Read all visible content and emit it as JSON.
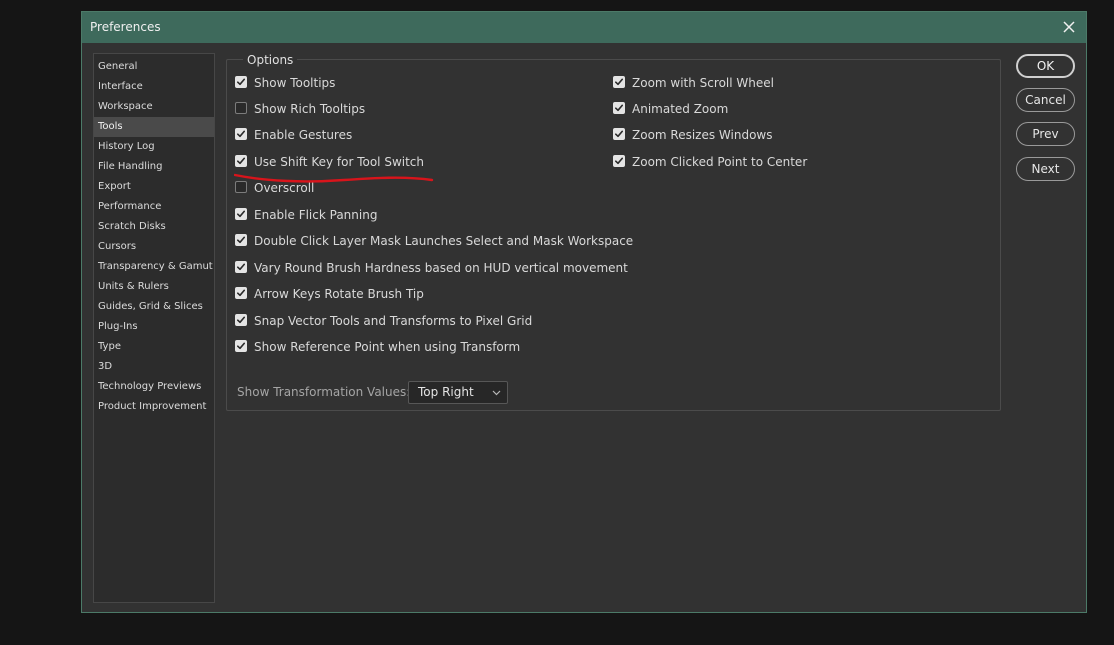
{
  "window": {
    "title": "Preferences"
  },
  "nav": {
    "items": [
      {
        "label": "General",
        "active": false
      },
      {
        "label": "Interface",
        "active": false
      },
      {
        "label": "Workspace",
        "active": false
      },
      {
        "label": "Tools",
        "active": true
      },
      {
        "label": "History Log",
        "active": false
      },
      {
        "label": "File Handling",
        "active": false
      },
      {
        "label": "Export",
        "active": false
      },
      {
        "label": "Performance",
        "active": false
      },
      {
        "label": "Scratch Disks",
        "active": false
      },
      {
        "label": "Cursors",
        "active": false
      },
      {
        "label": "Transparency & Gamut",
        "active": false
      },
      {
        "label": "Units & Rulers",
        "active": false
      },
      {
        "label": "Guides, Grid & Slices",
        "active": false
      },
      {
        "label": "Plug-Ins",
        "active": false
      },
      {
        "label": "Type",
        "active": false
      },
      {
        "label": "3D",
        "active": false
      },
      {
        "label": "Technology Previews",
        "active": false
      },
      {
        "label": "Product Improvement",
        "active": false
      }
    ]
  },
  "options": {
    "legend": "Options",
    "left": [
      {
        "label": "Show Tooltips",
        "checked": true
      },
      {
        "label": "Show Rich Tooltips",
        "checked": false
      },
      {
        "label": "Enable Gestures",
        "checked": true
      },
      {
        "label": "Use Shift Key for Tool Switch",
        "checked": true
      },
      {
        "label": "Overscroll",
        "checked": false
      },
      {
        "label": "Enable Flick Panning",
        "checked": true
      },
      {
        "label": "Double Click Layer Mask Launches Select and Mask Workspace",
        "checked": true
      },
      {
        "label": "Vary Round Brush Hardness based on HUD vertical movement",
        "checked": true
      },
      {
        "label": "Arrow Keys Rotate Brush Tip",
        "checked": true
      },
      {
        "label": "Snap Vector Tools and Transforms to Pixel Grid",
        "checked": true
      },
      {
        "label": "Show Reference Point when using Transform",
        "checked": true
      }
    ],
    "right": [
      {
        "label": "Zoom with Scroll Wheel",
        "checked": true
      },
      {
        "label": "Animated Zoom",
        "checked": true
      },
      {
        "label": "Zoom Resizes Windows",
        "checked": true
      },
      {
        "label": "Zoom Clicked Point to Center",
        "checked": true
      }
    ],
    "transformation_values": {
      "label": "Show Transformation Values:",
      "value": "Top Right"
    }
  },
  "buttons": {
    "ok": "OK",
    "cancel": "Cancel",
    "prev": "Prev",
    "next": "Next"
  },
  "colors": {
    "titlebar": "#3e6a5c",
    "annotation_underline": "#d8141b"
  }
}
